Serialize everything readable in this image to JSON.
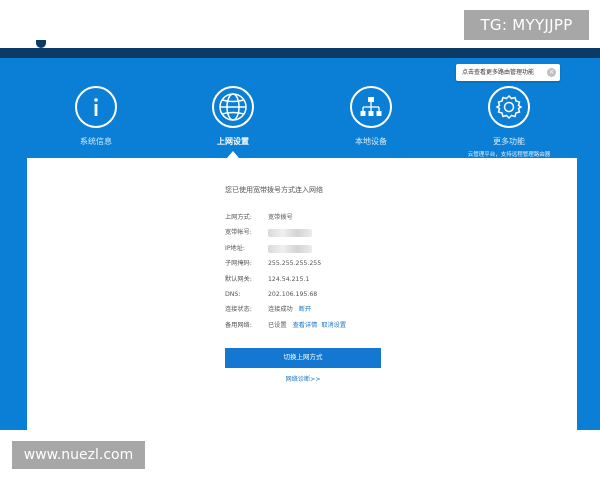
{
  "watermark_top": "TG: MYYJJPP",
  "watermark_bottom": "www.nuezl.com",
  "tooltip": {
    "text": "点击查看更多路由管理功能",
    "close_icon": "close-icon"
  },
  "nav": {
    "items": [
      {
        "label": "系统信息",
        "icon": "info-icon",
        "active": false
      },
      {
        "label": "上网设置",
        "icon": "globe-icon",
        "active": true
      },
      {
        "label": "本地设备",
        "icon": "network-icon",
        "active": false
      },
      {
        "label": "更多功能",
        "icon": "gear-icon",
        "active": false,
        "sub": "云管理平台，支持远程管理路由器"
      }
    ]
  },
  "panel": {
    "title": "您已使用宽带拨号方式连入网络",
    "rows": [
      {
        "key": "上网方式:",
        "value": "宽带拨号"
      },
      {
        "key": "宽带帐号:",
        "value": ""
      },
      {
        "key": "IP地址:",
        "value": ""
      },
      {
        "key": "子网掩码:",
        "value": "255.255.255.255"
      },
      {
        "key": "默认网关:",
        "value": "124.54.215.1"
      },
      {
        "key": "DNS:",
        "value": "202.106.195.68"
      },
      {
        "key": "连接状态:",
        "value": "连接成功",
        "link": "断开"
      },
      {
        "key": "备用网络:",
        "value": "已设置",
        "link": "查看详情",
        "link2": "取消设置"
      }
    ],
    "switch_button": "切换上网方式",
    "diag_link": "网络诊断>>"
  },
  "colors": {
    "header_blue": "#0b7fd6",
    "dark_band": "#0b3a66",
    "button_blue": "#1478d2",
    "link_blue": "#1a76c9"
  }
}
